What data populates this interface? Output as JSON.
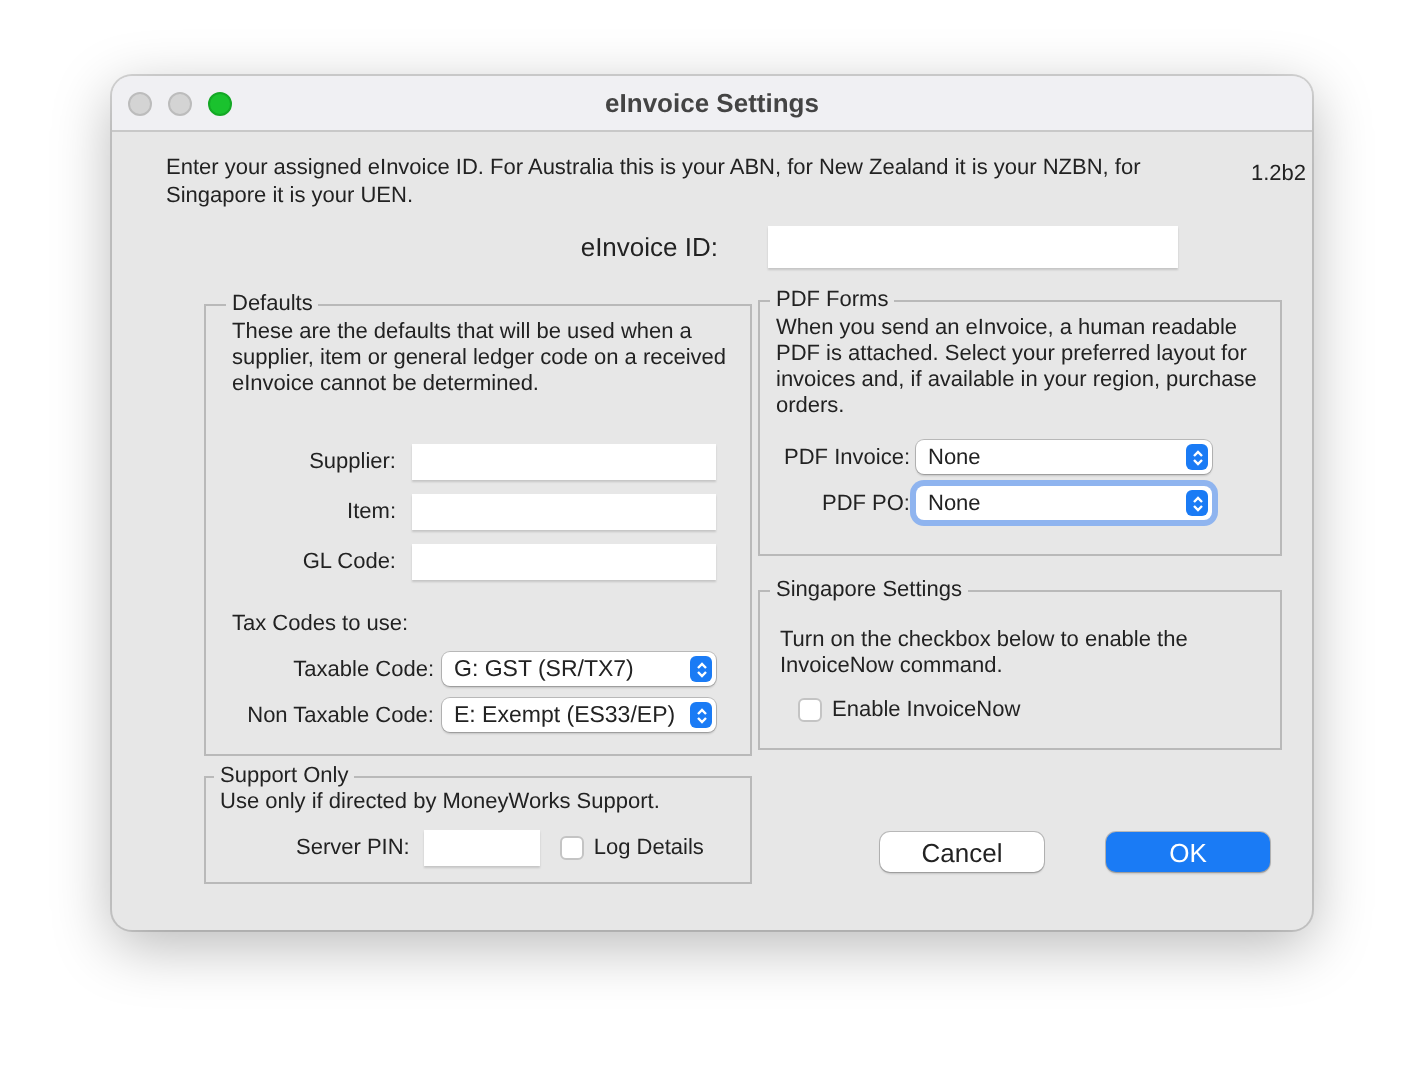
{
  "window": {
    "title": "eInvoice Settings",
    "version": "1.2b2"
  },
  "intro": "Enter your assigned eInvoice ID. For Australia this is your ABN, for New Zealand it is your NZBN, for Singapore it is your UEN.",
  "einvoice_id": {
    "label": "eInvoice ID:"
  },
  "defaults": {
    "title": "Defaults",
    "description": "These are the defaults that will be used when a supplier, item or general ledger code on a received eInvoice cannot be determined.",
    "fields": [
      {
        "label": "Supplier:"
      },
      {
        "label": "Item:"
      },
      {
        "label": "GL Code:"
      }
    ],
    "tax_heading": "Tax Codes to use:",
    "tax_codes": [
      {
        "label": "Taxable Code:",
        "value": "G: GST (SR/TX7)",
        "focused": false
      },
      {
        "label": "Non Taxable Code:",
        "value": "E: Exempt (ES33/EP)",
        "focused": false
      }
    ]
  },
  "support": {
    "title": "Support Only",
    "description": "Use only if directed by MoneyWorks Support.",
    "pin_label": "Server PIN:",
    "log": {
      "label": "Log Details",
      "checked": false
    }
  },
  "pdf_forms": {
    "title": "PDF Forms",
    "description": "When you send an eInvoice, a human readable PDF is attached. Select your preferred layout for invoices and, if available in your region, purchase orders.",
    "popups": [
      {
        "label": "PDF Invoice:",
        "value": "None",
        "focused": false
      },
      {
        "label": "PDF PO:",
        "value": "None",
        "focused": true
      }
    ]
  },
  "singapore": {
    "title": "Singapore Settings",
    "description": "Turn on the checkbox below to enable the InvoiceNow command.",
    "checkbox": {
      "label": "Enable InvoiceNow",
      "checked": false
    }
  },
  "buttons": [
    {
      "label": "Cancel",
      "default": false
    },
    {
      "label": "OK",
      "default": true
    }
  ]
}
